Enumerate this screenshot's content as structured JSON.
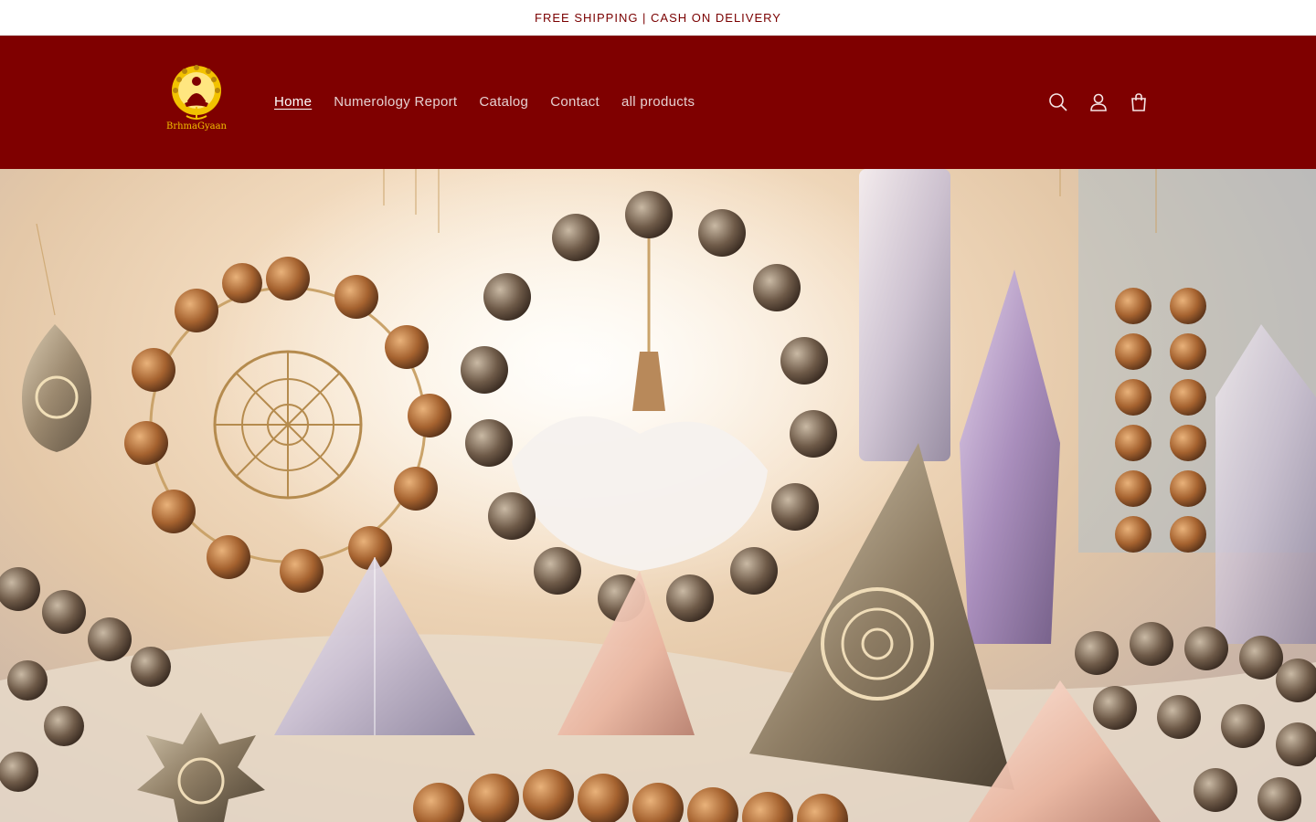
{
  "announcement": {
    "text": "FREE SHIPPING | CASH ON DELIVERY"
  },
  "header": {
    "logo_text": "BrhmaGyaan",
    "nav": [
      {
        "label": "Home",
        "active": true
      },
      {
        "label": "Numerology Report",
        "active": false
      },
      {
        "label": "Catalog",
        "active": false
      },
      {
        "label": "Contact",
        "active": false
      },
      {
        "label": "all products",
        "active": false
      }
    ],
    "icons": [
      "search-icon",
      "account-icon",
      "cart-icon"
    ]
  },
  "hero": {
    "image": "rudraksha-crystal-pyramid-banner"
  },
  "colors": {
    "brand": "#7f0000",
    "announcement_text": "#7a0000",
    "logo": "#f2c200"
  }
}
